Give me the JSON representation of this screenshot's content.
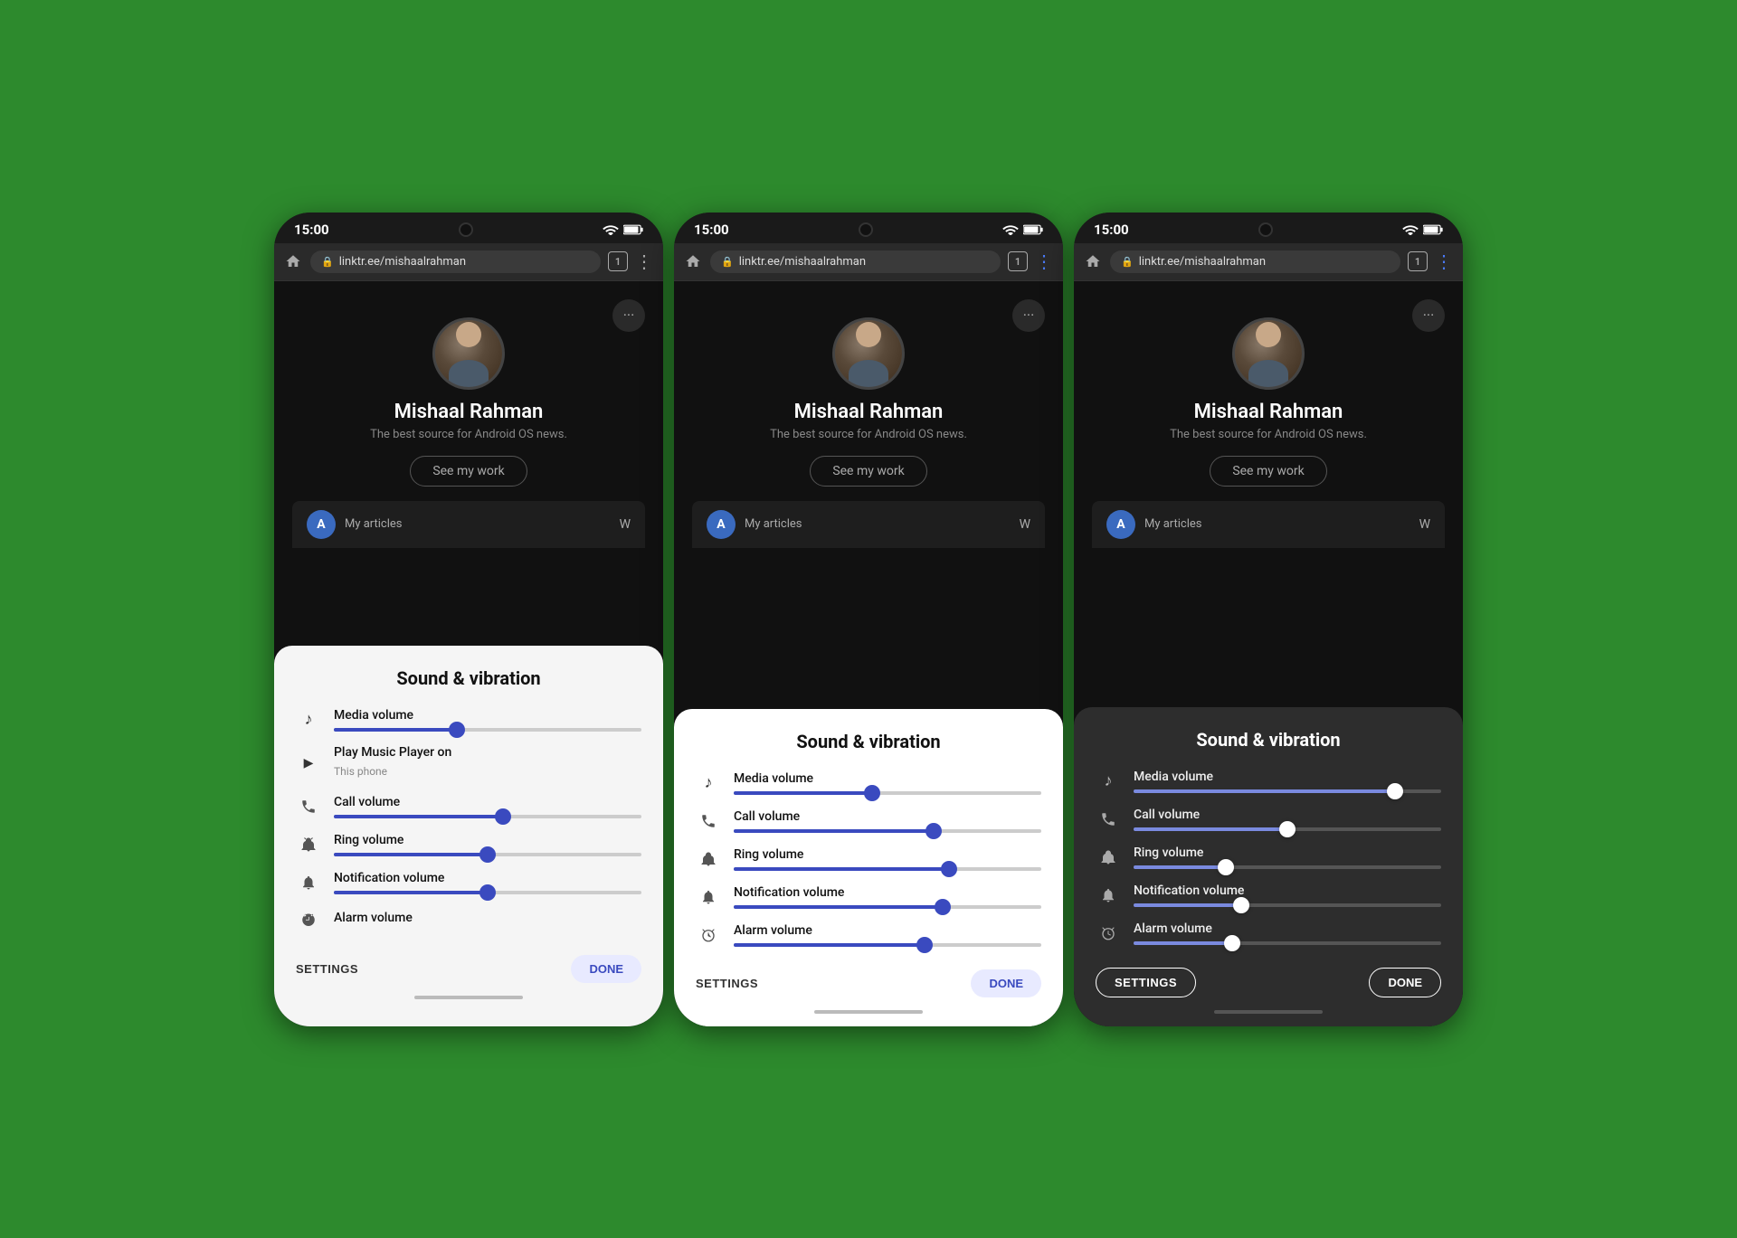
{
  "phones": [
    {
      "id": "phone1",
      "theme": "light",
      "statusBar": {
        "time": "15:00"
      },
      "browser": {
        "url": "linktr.ee/mishaalrahman",
        "tabCount": "1"
      },
      "profile": {
        "name": "Mishaal Rahman",
        "subtitle": "The best source for Android OS news.",
        "seeWork": "See my work",
        "articlesAvatar": "A",
        "articlesLabel": "My articles",
        "moreLabel": "W"
      },
      "soundPanel": {
        "title": "Sound & vibration",
        "rows": [
          {
            "label": "Media volume",
            "sublabel": "",
            "icon": "music",
            "fillPercent": 40,
            "thumbPercent": 40
          },
          {
            "label": "Play Music Player on",
            "sublabel": "This phone",
            "icon": "play",
            "fillPercent": 0,
            "thumbPercent": 0,
            "isInfo": true
          },
          {
            "label": "Call volume",
            "fillPercent": 55,
            "thumbPercent": 55,
            "icon": "phone"
          },
          {
            "label": "Ring volume",
            "fillPercent": 50,
            "thumbPercent": 50,
            "icon": "ring"
          },
          {
            "label": "Notification volume",
            "fillPercent": 50,
            "thumbPercent": 50,
            "icon": "bell"
          },
          {
            "label": "Alarm volume",
            "fillPercent": 0,
            "thumbPercent": 0,
            "icon": "alarm",
            "showOnly": true
          }
        ],
        "settingsLabel": "SETTINGS",
        "doneLabel": "DONE"
      }
    },
    {
      "id": "phone2",
      "theme": "white",
      "statusBar": {
        "time": "15:00"
      },
      "browser": {
        "url": "linktr.ee/mishaalrahman",
        "tabCount": "1"
      },
      "profile": {
        "name": "Mishaal Rahman",
        "subtitle": "The best source for Android OS news.",
        "seeWork": "See my work",
        "articlesAvatar": "A",
        "articlesLabel": "My articles",
        "moreLabel": "W"
      },
      "soundPanel": {
        "title": "Sound & vibration",
        "rows": [
          {
            "label": "Media volume",
            "sublabel": "",
            "icon": "music",
            "fillPercent": 45,
            "thumbPercent": 45
          },
          {
            "label": "Call volume",
            "fillPercent": 65,
            "thumbPercent": 65,
            "icon": "phone"
          },
          {
            "label": "Ring volume",
            "fillPercent": 70,
            "thumbPercent": 70,
            "icon": "ring"
          },
          {
            "label": "Notification volume",
            "fillPercent": 68,
            "thumbPercent": 68,
            "icon": "bell"
          },
          {
            "label": "Alarm volume",
            "fillPercent": 62,
            "thumbPercent": 62,
            "icon": "alarm"
          }
        ],
        "settingsLabel": "SETTINGS",
        "doneLabel": "DONE"
      }
    },
    {
      "id": "phone3",
      "theme": "dark",
      "statusBar": {
        "time": "15:00"
      },
      "browser": {
        "url": "linktr.ee/mishaalrahman",
        "tabCount": "1"
      },
      "profile": {
        "name": "Mishaal Rahman",
        "subtitle": "The best source for Android OS news.",
        "seeWork": "See my work",
        "articlesAvatar": "A",
        "articlesLabel": "My articles",
        "moreLabel": "W"
      },
      "soundPanel": {
        "title": "Sound & vibration",
        "rows": [
          {
            "label": "Media volume",
            "sublabel": "",
            "icon": "music",
            "fillPercent": 85,
            "thumbPercent": 85
          },
          {
            "label": "Call volume",
            "fillPercent": 50,
            "thumbPercent": 50,
            "icon": "phone"
          },
          {
            "label": "Ring volume",
            "fillPercent": 30,
            "thumbPercent": 30,
            "icon": "ring"
          },
          {
            "label": "Notification volume",
            "fillPercent": 35,
            "thumbPercent": 35,
            "icon": "bell"
          },
          {
            "label": "Alarm volume",
            "fillPercent": 32,
            "thumbPercent": 32,
            "icon": "alarm"
          }
        ],
        "settingsLabel": "SETTINGS",
        "doneLabel": "DONE"
      }
    }
  ],
  "icons": {
    "music": "♪",
    "phone": "✆",
    "ring": "📳",
    "bell": "🔔",
    "alarm": "⏰",
    "play": "▶",
    "lock": "🔒",
    "home": "⌂",
    "dots": "⋯"
  }
}
